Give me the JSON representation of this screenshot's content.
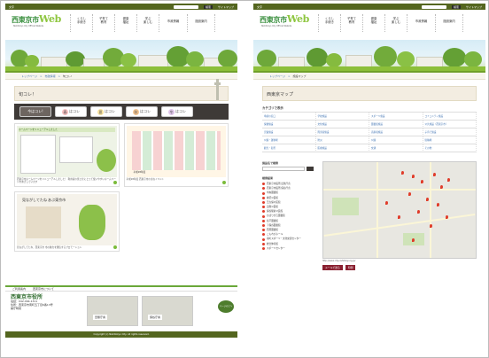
{
  "topbar": {
    "left": "文字",
    "right_search_btn": "検索",
    "right_sitemap": "サイトマップ"
  },
  "logo": {
    "text": "西東京市",
    "web": "Web",
    "sub": "Nishitokyo City Official Website"
  },
  "gnav": [
    {
      "l": "くらし\n手続き"
    },
    {
      "l": "子育て\n教育"
    },
    {
      "l": "健康\n福祉"
    },
    {
      "l": "学ぶ\n楽しむ"
    },
    {
      "l": "市政情報"
    },
    {
      "l": "施設案内"
    }
  ],
  "left": {
    "breadcrumb": [
      "トップページ",
      "市政情報",
      "旬コレ!"
    ],
    "title": "旬コレ！",
    "seasons": [
      {
        "l": "今はコレ!",
        "c": "#6d6560"
      },
      {
        "l": "はコレ",
        "k": "春",
        "c": "#f08a8a"
      },
      {
        "l": "はコレ",
        "k": "夏",
        "c": "#f5d36b"
      },
      {
        "l": "はコレ",
        "k": "秋",
        "c": "#f2a24a"
      },
      {
        "l": "はコレ",
        "k": "冬",
        "c": "#c89ad6"
      }
    ],
    "cards": [
      {
        "img_text": "ホームページをリニューアルしました",
        "cap": "西東京市ホームページをリニューアルしました！ 利用者の皆さまにとって使いやすいホームページをめざしています"
      },
      {
        "img_text": "平成28年度",
        "cap": "平成28年度 西東京市の主なイベント"
      },
      {
        "img_text": "見ながしてたね あぶ東京市",
        "cap": "見ながしてたね、西東京市 市の魅力を発信するプロモーション"
      },
      {
        "img_text": "",
        "cap": ""
      }
    ],
    "footer": {
      "city": "西東京市役所",
      "tel": "電話：042-464-1311",
      "addr": "住所：西東京市南町五丁目6番13号",
      "hours": "開庁時間",
      "offices": [
        {
          "name": "田無庁舎"
        },
        {
          "name": "保谷庁舎"
        }
      ],
      "pagetop": "ページの上へ",
      "nav": [
        "ご利用案内",
        "西東京市について"
      ]
    },
    "copyright": "Copyright (c) Nishitokyo City. All rights reserved."
  },
  "right": {
    "breadcrumb": [
      "トップページ",
      "施設マップ"
    ],
    "title": "西東京マップ",
    "category_head": "カテゴリで表示",
    "categories": [
      "申請の窓口",
      "学校施設",
      "スポーツ施設",
      "コミュニティ施設",
      "保健施設",
      "文化施設",
      "図書館施設",
      "公共施設（西東京市）",
      "児童施設",
      "障害者施設",
      "高齢者施設",
      "子育て施設",
      "公園・運動場",
      "防災",
      "公園",
      "駐輪場",
      "観光・名所",
      "医療施設",
      "交通",
      "その他"
    ],
    "search_head": "施設名で検索",
    "results_head": "検索結果",
    "results": [
      "西東京市役所 田無庁舎",
      "西東京市役所 保谷庁舎",
      "中央図書館",
      "柳沢公民館",
      "芝久保公民館",
      "田無公民館",
      "保谷駅前公民館",
      "ひばりが丘図書館",
      "谷戸図書館",
      "下保谷図書館",
      "西原図書館",
      "こもれびホール",
      "南町スポーツ・文化交流センター",
      "総合体育館",
      "スポーツセンター"
    ],
    "map_url": "http://www.city.nishitokyo.lg.jp/",
    "map_btns": [
      "メールで送る",
      "印刷"
    ]
  }
}
